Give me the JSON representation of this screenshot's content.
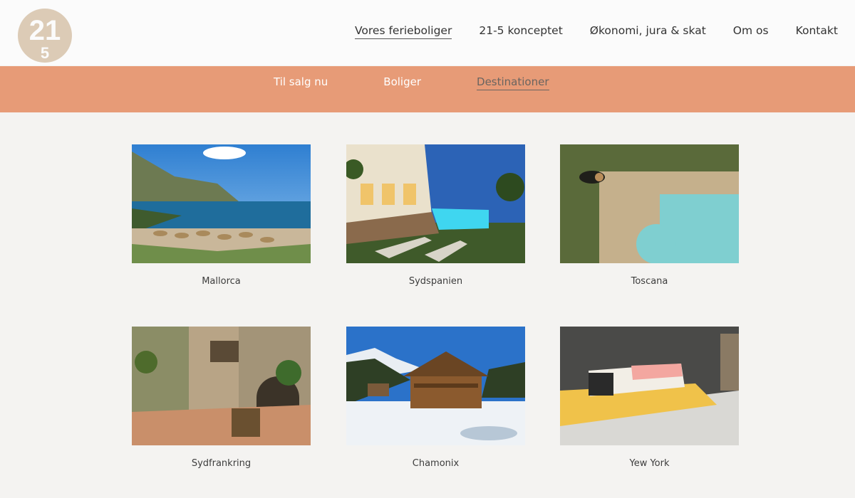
{
  "logo": {
    "text": "21-5"
  },
  "main_nav": [
    {
      "label": "Vores ferieboliger",
      "active": true
    },
    {
      "label": "21-5 konceptet",
      "active": false
    },
    {
      "label": "Økonomi, jura & skat",
      "active": false
    },
    {
      "label": "Om os",
      "active": false
    },
    {
      "label": "Kontakt",
      "active": false
    }
  ],
  "sub_nav": [
    {
      "label": "Til salg nu",
      "active": false
    },
    {
      "label": "Boliger",
      "active": false
    },
    {
      "label": "Destinationer",
      "active": true
    }
  ],
  "destinations": [
    {
      "label": "Mallorca"
    },
    {
      "label": "Sydspanien"
    },
    {
      "label": "Toscana"
    },
    {
      "label": "Sydfrankring"
    },
    {
      "label": "Chamonix"
    },
    {
      "label": "Yew York"
    }
  ],
  "colors": {
    "subbar": "#e79b77",
    "logo": "#d9c9b4"
  }
}
